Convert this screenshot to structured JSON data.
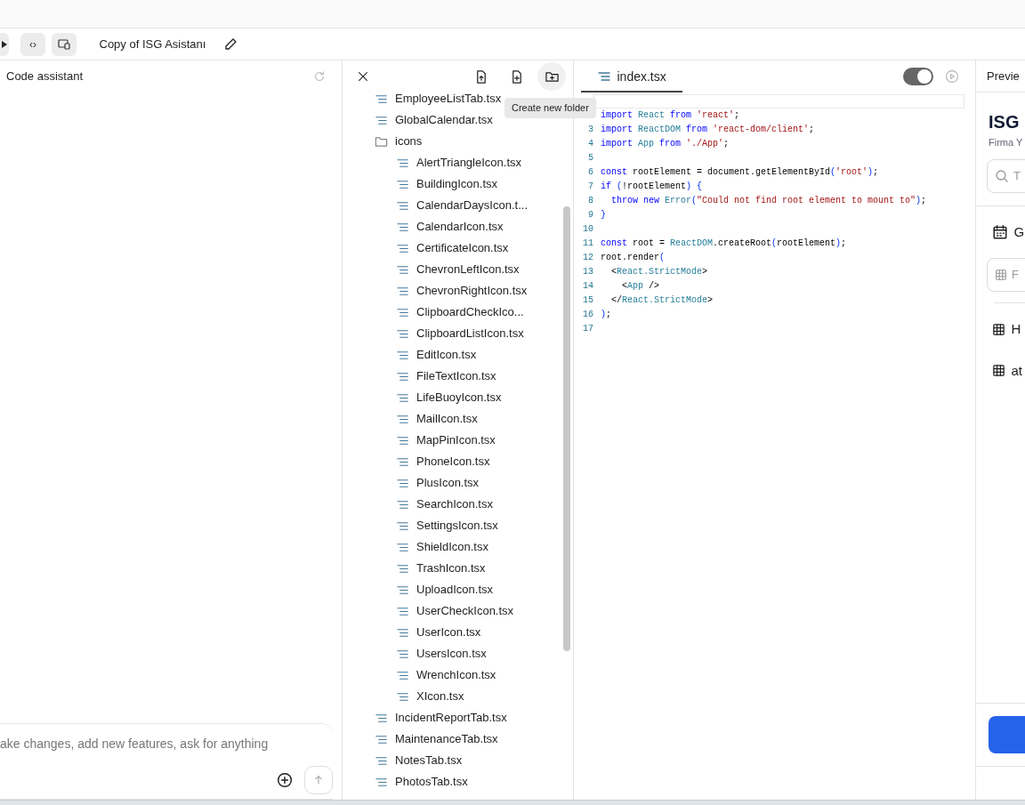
{
  "toolbar": {
    "title": "Copy of ISG Asistanı",
    "code_view": "‹›"
  },
  "assistant": {
    "title": "Code assistant",
    "placeholder": "ake changes, add new features, ask for anything"
  },
  "file_tree": {
    "tooltip": "Create new folder",
    "items": [
      {
        "kind": "file",
        "name": "EmployeeListTab.tsx"
      },
      {
        "kind": "file",
        "name": "GlobalCalendar.tsx"
      },
      {
        "kind": "folder",
        "name": "icons",
        "children": [
          {
            "kind": "file",
            "name": "AlertTriangleIcon.tsx"
          },
          {
            "kind": "file",
            "name": "BuildingIcon.tsx"
          },
          {
            "kind": "file",
            "name": "CalendarDaysIcon.t..."
          },
          {
            "kind": "file",
            "name": "CalendarIcon.tsx"
          },
          {
            "kind": "file",
            "name": "CertificateIcon.tsx"
          },
          {
            "kind": "file",
            "name": "ChevronLeftIcon.tsx"
          },
          {
            "kind": "file",
            "name": "ChevronRightIcon.tsx"
          },
          {
            "kind": "file",
            "name": "ClipboardCheckIco..."
          },
          {
            "kind": "file",
            "name": "ClipboardListIcon.tsx"
          },
          {
            "kind": "file",
            "name": "EditIcon.tsx"
          },
          {
            "kind": "file",
            "name": "FileTextIcon.tsx"
          },
          {
            "kind": "file",
            "name": "LifeBuoyIcon.tsx"
          },
          {
            "kind": "file",
            "name": "MailIcon.tsx"
          },
          {
            "kind": "file",
            "name": "MapPinIcon.tsx"
          },
          {
            "kind": "file",
            "name": "PhoneIcon.tsx"
          },
          {
            "kind": "file",
            "name": "PlusIcon.tsx"
          },
          {
            "kind": "file",
            "name": "SearchIcon.tsx"
          },
          {
            "kind": "file",
            "name": "SettingsIcon.tsx"
          },
          {
            "kind": "file",
            "name": "ShieldIcon.tsx"
          },
          {
            "kind": "file",
            "name": "TrashIcon.tsx"
          },
          {
            "kind": "file",
            "name": "UploadIcon.tsx"
          },
          {
            "kind": "file",
            "name": "UserCheckIcon.tsx"
          },
          {
            "kind": "file",
            "name": "UserIcon.tsx"
          },
          {
            "kind": "file",
            "name": "UsersIcon.tsx"
          },
          {
            "kind": "file",
            "name": "WrenchIcon.tsx"
          },
          {
            "kind": "file",
            "name": "XIcon.tsx"
          }
        ]
      },
      {
        "kind": "file",
        "name": "IncidentReportTab.tsx"
      },
      {
        "kind": "file",
        "name": "MaintenanceTab.tsx"
      },
      {
        "kind": "file",
        "name": "NotesTab.tsx"
      },
      {
        "kind": "file",
        "name": "PhotosTab.tsx"
      }
    ]
  },
  "editor": {
    "tab": "index.tsx",
    "toggle_on": true,
    "lines": [
      {
        "active": true
      },
      {
        "tokens": [
          {
            "kind": "kw",
            "text": "import "
          },
          {
            "kind": "type",
            "text": "React "
          },
          {
            "kind": "kw",
            "text": "from "
          },
          {
            "kind": "str",
            "text": "'react'"
          },
          {
            "kind": "plain",
            "text": ";"
          }
        ]
      },
      {
        "number": "3",
        "tokens": [
          {
            "kind": "kw",
            "text": "import "
          },
          {
            "kind": "type",
            "text": "ReactDOM "
          },
          {
            "kind": "kw",
            "text": "from "
          },
          {
            "kind": "str",
            "text": "'react-dom/client'"
          },
          {
            "kind": "plain",
            "text": ";"
          }
        ]
      },
      {
        "number": "4",
        "tokens": [
          {
            "kind": "kw",
            "text": "import "
          },
          {
            "kind": "type",
            "text": "App "
          },
          {
            "kind": "kw",
            "text": "from "
          },
          {
            "kind": "str",
            "text": "'./App'"
          },
          {
            "kind": "plain",
            "text": ";"
          }
        ]
      },
      {
        "number": "5"
      },
      {
        "number": "6",
        "tokens": [
          {
            "kind": "kw",
            "text": "const"
          },
          {
            "kind": "plain",
            "text": " rootElement = document.getElementById"
          },
          {
            "kind": "bracket",
            "text": "("
          },
          {
            "kind": "str",
            "text": "'root'"
          },
          {
            "kind": "bracket",
            "text": ")"
          },
          {
            "kind": "plain",
            "text": ";"
          }
        ]
      },
      {
        "number": "7",
        "tokens": [
          {
            "kind": "kw",
            "text": "if "
          },
          {
            "kind": "bracket",
            "text": "("
          },
          {
            "kind": "plain",
            "text": "!rootElement"
          },
          {
            "kind": "bracket",
            "text": ") {"
          }
        ]
      },
      {
        "number": "8",
        "tokens": [
          {
            "kind": "kw",
            "text": "  throw new "
          },
          {
            "kind": "type",
            "text": "Error"
          },
          {
            "kind": "bracket",
            "text": "("
          },
          {
            "kind": "str",
            "text": "\"Could not find root element to mount to\""
          },
          {
            "kind": "bracket",
            "text": ")"
          },
          {
            "kind": "plain",
            "text": ";"
          }
        ]
      },
      {
        "number": "9",
        "tokens": [
          {
            "kind": "bracket",
            "text": "}"
          }
        ]
      },
      {
        "number": "10"
      },
      {
        "number": "11",
        "tokens": [
          {
            "kind": "kw",
            "text": "const"
          },
          {
            "kind": "plain",
            "text": " root = "
          },
          {
            "kind": "type",
            "text": "ReactDOM"
          },
          {
            "kind": "plain",
            "text": ".createRoot"
          },
          {
            "kind": "bracket",
            "text": "("
          },
          {
            "kind": "plain",
            "text": "rootElement"
          },
          {
            "kind": "bracket",
            "text": ")"
          },
          {
            "kind": "plain",
            "text": ";"
          }
        ]
      },
      {
        "number": "12",
        "tokens": [
          {
            "kind": "plain",
            "text": "root.render"
          },
          {
            "kind": "bracket",
            "text": "("
          }
        ]
      },
      {
        "number": "13",
        "tokens": [
          {
            "kind": "plain",
            "text": "  <"
          },
          {
            "kind": "type",
            "text": "React.StrictMode"
          },
          {
            "kind": "plain",
            "text": ">"
          }
        ]
      },
      {
        "number": "14",
        "tokens": [
          {
            "kind": "plain",
            "text": "    <"
          },
          {
            "kind": "type",
            "text": "App"
          },
          {
            "kind": "plain",
            "text": " />"
          }
        ]
      },
      {
        "number": "15",
        "tokens": [
          {
            "kind": "plain",
            "text": "  </"
          },
          {
            "kind": "type",
            "text": "React.StrictMode"
          },
          {
            "kind": "plain",
            "text": ">"
          }
        ]
      },
      {
        "number": "16",
        "tokens": [
          {
            "kind": "bracket",
            "text": ")"
          },
          {
            "kind": "plain",
            "text": ";"
          }
        ]
      },
      {
        "number": "17"
      }
    ]
  },
  "preview": {
    "title": "Previe",
    "app_title": "ISG",
    "app_subtitle": "Firma Y",
    "search_placeholder": "T",
    "nav_label": "G",
    "select_placeholder": "F",
    "items": [
      "H",
      "at"
    ]
  }
}
